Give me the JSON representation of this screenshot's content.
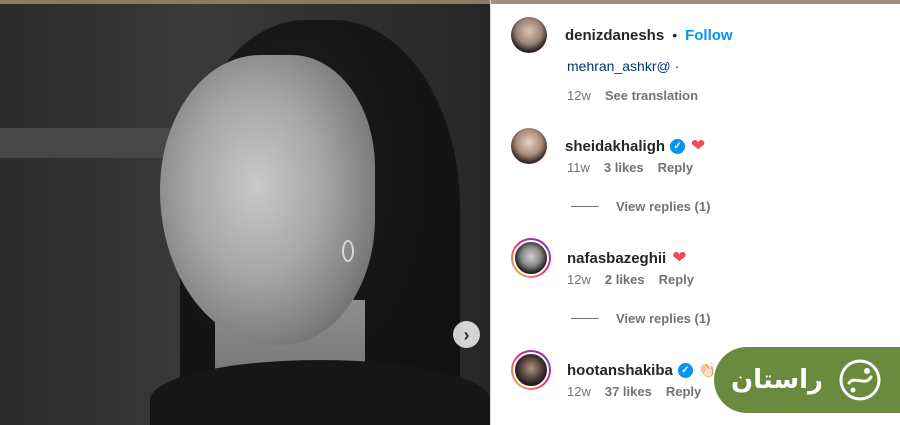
{
  "post": {
    "author": "denizdaneshs",
    "separator": "•",
    "follow_label": "Follow"
  },
  "truncated_comment": {
    "text": "mehran_ashkr@ ·",
    "age": "12w",
    "see_translation": "See translation"
  },
  "comments": [
    {
      "username": "sheidakhaligh",
      "verified": true,
      "emoji": "❤",
      "age": "11w",
      "likes": "3 likes",
      "reply_label": "Reply",
      "view_replies": "View replies (1)"
    },
    {
      "username": "nafasbazeghii",
      "verified": false,
      "emoji": "❤",
      "age": "12w",
      "likes": "2 likes",
      "reply_label": "Reply",
      "view_replies": "View replies (1)"
    },
    {
      "username": "hootanshakiba",
      "verified": true,
      "emoji": "👏🏻",
      "age": "12w",
      "likes": "37 likes",
      "reply_label": "Reply"
    }
  ],
  "watermark": {
    "text": "راستان"
  },
  "colors": {
    "follow": "#0095f6",
    "heart": "#ed4956",
    "badge": "#6a8b3d"
  }
}
